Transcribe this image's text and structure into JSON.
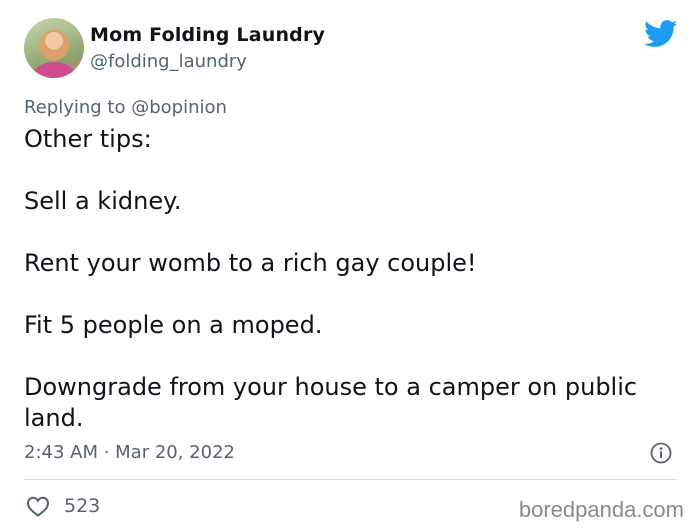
{
  "author": {
    "name": "Mom Folding Laundry",
    "handle": "@folding_laundry"
  },
  "reply": {
    "prefix": "Replying to ",
    "mention": "@bopinion"
  },
  "tweet": {
    "lines": [
      "Other tips:",
      "Sell a kidney.",
      "Rent your womb to a rich gay couple!",
      "Fit 5 people on a moped.",
      "Downgrade from your house to a camper on public land."
    ]
  },
  "meta": {
    "timestamp": "2:43 AM · Mar 20, 2022",
    "likes": "523"
  },
  "watermark": "boredpanda.com",
  "colors": {
    "twitter_blue": "#1d9bf0",
    "secondary_text": "#536471"
  },
  "icons": [
    "twitter-bird-icon",
    "info-icon",
    "heart-icon"
  ]
}
